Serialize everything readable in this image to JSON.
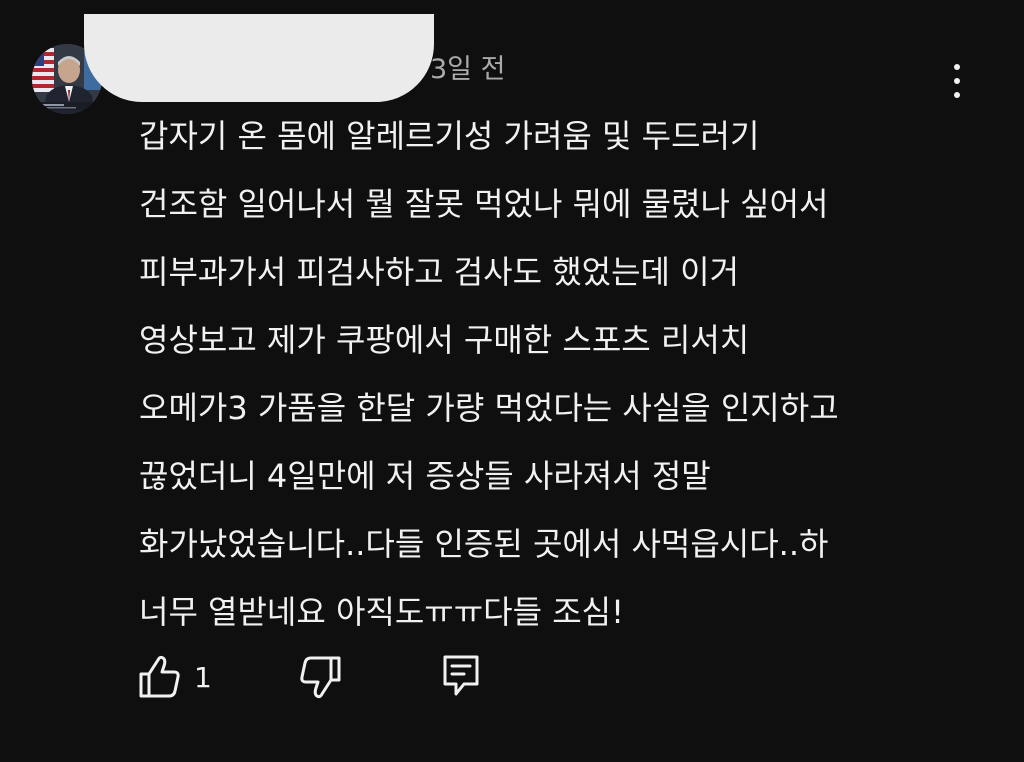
{
  "comment": {
    "timestamp": "3일 전",
    "lines": [
      "갑자기 온 몸에 알레르기성 가려움 및 두드러기",
      "건조함 일어나서 뭘 잘못 먹었나 뭐에 물렸나 싶어서",
      "피부과가서 피검사하고 검사도 했었는데 이거",
      "영상보고 제가 쿠팡에서 구매한 스포츠 리서치",
      "오메가3 가품을 한달 가량 먹었다는 사실을 인지하고",
      "끊었더니 4일만에 저 증상들 사라져서 정말",
      "화가났었습니다..다들 인증된 곳에서 사먹읍시다..하",
      "너무 열받네요 아직도ㅠㅠ다들 조심!"
    ]
  },
  "actions": {
    "like_count": "1",
    "like_icon": "thumbs-up-icon",
    "dislike_icon": "thumbs-down-icon",
    "reply_icon": "reply-comment-icon"
  },
  "menu": {
    "icon": "more-vertical-icon"
  },
  "colors": {
    "background": "#0f0f0f",
    "text": "#f1f1f1",
    "secondary_text": "#aaaaaa",
    "redaction": "#ebebeb"
  }
}
